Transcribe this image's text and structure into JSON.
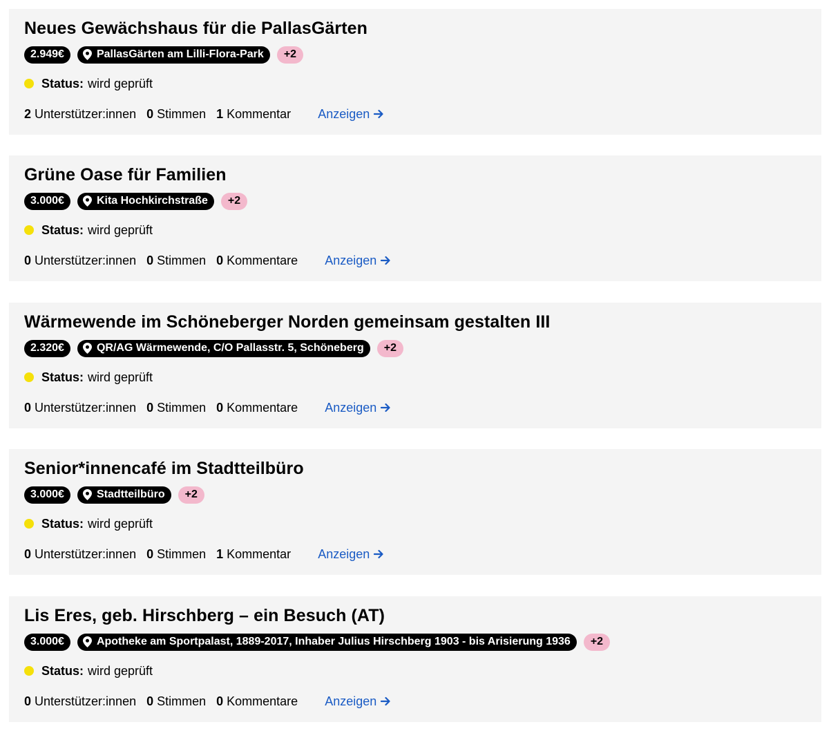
{
  "status_label": "Status:",
  "link_label": "Anzeigen",
  "proposals": [
    {
      "title": "Neues Gewächshaus für die PallasGärten",
      "budget": "2.949€",
      "location": "PallasGärten am Lilli-Flora-Park",
      "more_tags": "+2",
      "status_value": "wird geprüft",
      "supporters_count": "2",
      "supporters_label": "Unterstützer:innen",
      "votes_count": "0",
      "votes_label": "Stimmen",
      "comments_count": "1",
      "comments_label": "Kommentar"
    },
    {
      "title": "Grüne Oase für Familien",
      "budget": "3.000€",
      "location": "Kita Hochkirchstraße",
      "more_tags": "+2",
      "status_value": "wird geprüft",
      "supporters_count": "0",
      "supporters_label": "Unterstützer:innen",
      "votes_count": "0",
      "votes_label": "Stimmen",
      "comments_count": "0",
      "comments_label": "Kommentare"
    },
    {
      "title": "Wärmewende im Schöneberger Norden gemeinsam gestalten III",
      "budget": "2.320€",
      "location": "QR/AG Wärmewende, C/O Pallasstr. 5, Schöneberg",
      "more_tags": "+2",
      "status_value": "wird geprüft",
      "supporters_count": "0",
      "supporters_label": "Unterstützer:innen",
      "votes_count": "0",
      "votes_label": "Stimmen",
      "comments_count": "0",
      "comments_label": "Kommentare"
    },
    {
      "title": "Senior*innencafé im Stadtteilbüro",
      "budget": "3.000€",
      "location": "Stadtteilbüro",
      "more_tags": "+2",
      "status_value": "wird geprüft",
      "supporters_count": "0",
      "supporters_label": "Unterstützer:innen",
      "votes_count": "0",
      "votes_label": "Stimmen",
      "comments_count": "1",
      "comments_label": "Kommentar"
    },
    {
      "title": "Lis Eres, geb. Hirschberg – ein Besuch (AT)",
      "budget": "3.000€",
      "location": "Apotheke am Sportpalast, 1889-2017, Inhaber Julius Hirschberg 1903 - bis Arisierung 1936",
      "more_tags": "+2",
      "status_value": "wird geprüft",
      "supporters_count": "0",
      "supporters_label": "Unterstützer:innen",
      "votes_count": "0",
      "votes_label": "Stimmen",
      "comments_count": "0",
      "comments_label": "Kommentare"
    }
  ],
  "colors": {
    "card_background": "#f4f4f4",
    "status_dot": "#f5e00a",
    "more_tag": "#f3b8cc",
    "link": "#1a5bc4"
  },
  "icons": {
    "location": "map-pin-icon",
    "status": "status-dot-icon",
    "link": "arrow-right-icon"
  }
}
